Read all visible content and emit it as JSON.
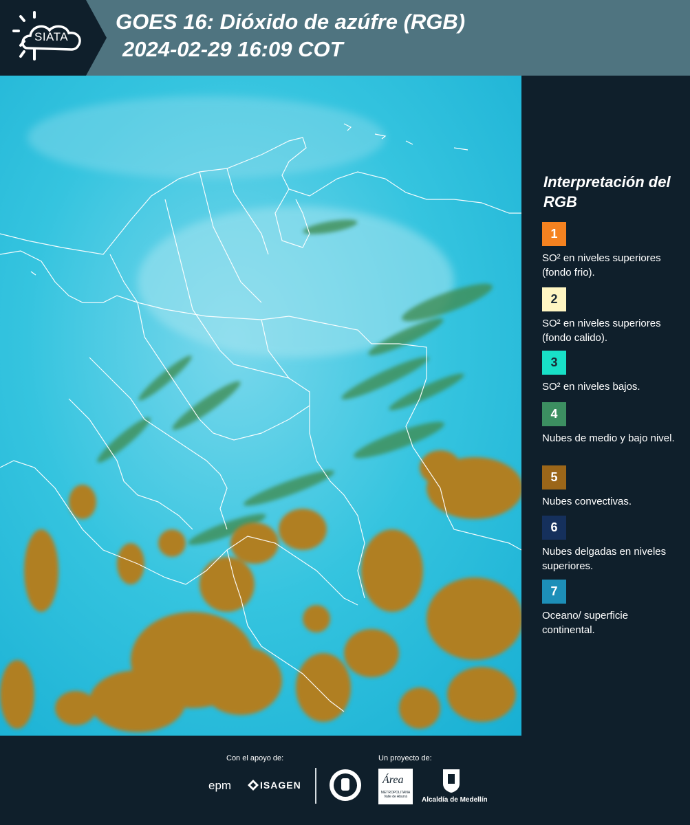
{
  "header": {
    "title": "GOES 16: Dióxido de azúfre (RGB)",
    "subtitle": "2024-02-29 16:09 COT",
    "logo_text": "SIATA"
  },
  "map": {
    "description_icon": "satellite-rgb-map",
    "colors": {
      "background_cyan": "#2ec2dc",
      "clouds_convective": "#b07f21",
      "clouds_low_green": "#3f8d52",
      "borders": "#ffffff"
    }
  },
  "legend": {
    "title": "Interpretación del RGB",
    "items": [
      {
        "number": "1",
        "label": "SO² en niveles superiores (fondo frio).",
        "color": "#f58220",
        "text_color": "#ffffff"
      },
      {
        "number": "2",
        "label": "SO² en niveles superiores (fondo calido).",
        "color": "#fff6c2",
        "text_color": "#1b2a35"
      },
      {
        "number": "3",
        "label": "SO² en niveles bajos.",
        "color": "#18e0c7",
        "text_color": "#1b2a35"
      },
      {
        "number": "4",
        "label": "Nubes de medio y bajo nivel.",
        "color": "#3c8f61",
        "text_color": "#ffffff"
      },
      {
        "number": "5",
        "label": "Nubes convectivas.",
        "color": "#9b6619",
        "text_color": "#ffffff"
      },
      {
        "number": "6",
        "label": "Nubes delgadas en niveles superiores.",
        "color": "#15305c",
        "text_color": "#ffffff"
      },
      {
        "number": "7",
        "label": "Oceano/ superficie continental.",
        "color": "#1d8fb8",
        "text_color": "#ffffff"
      }
    ]
  },
  "footer": {
    "support_label": "Con el apoyo de:",
    "project_label": "Un proyecto de:",
    "sponsors": {
      "epm": "epm",
      "isagen": "ISAGEN",
      "area": "Área",
      "area_sub": "METROPOLITANA Valle de Aburrá",
      "alcaldia": "Alcaldía de Medellín"
    }
  }
}
